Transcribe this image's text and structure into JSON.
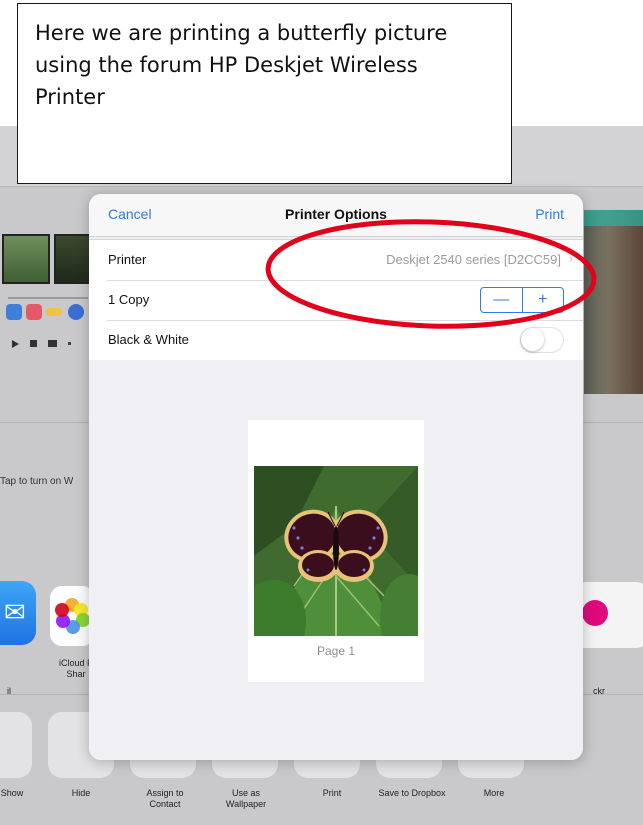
{
  "caption": {
    "text": "Here we are printing a butterfly picture using the forum HP Deskjet Wireless Printer"
  },
  "dialog": {
    "cancel_label": "Cancel",
    "title": "Printer Options",
    "print_label": "Print",
    "printer": {
      "label": "Printer",
      "value": "Deskjet 2540 series [D2CC59]"
    },
    "copies": {
      "label": "1 Copy",
      "decrement_glyph": "—",
      "increment_glyph": "+"
    },
    "black_white": {
      "label": "Black & White",
      "enabled": false
    },
    "preview": {
      "page_label": "Page 1"
    }
  },
  "background": {
    "tap_text": "Tap to turn on W",
    "share_apps": [
      {
        "label": "il",
        "icon": "mail-icon"
      },
      {
        "label": "iCloud P\nShar",
        "icon": "photos-icon"
      },
      {
        "label": "ckr",
        "icon": "flickr-icon"
      }
    ],
    "actions": [
      {
        "label": "Show",
        "icon": "slideshow-icon"
      },
      {
        "label": "Hide",
        "icon": "hide-icon"
      },
      {
        "label": "Assign to\nContact",
        "icon": "contact-icon"
      },
      {
        "label": "Use as\nWallpaper",
        "icon": "wallpaper-icon"
      },
      {
        "label": "Print",
        "icon": "print-icon"
      },
      {
        "label": "Save to Dropbox",
        "icon": "dropbox-icon"
      },
      {
        "label": "More",
        "icon": "more-icon"
      }
    ]
  },
  "colors": {
    "accent": "#2f7ae5",
    "annotation": "#e3001b"
  }
}
